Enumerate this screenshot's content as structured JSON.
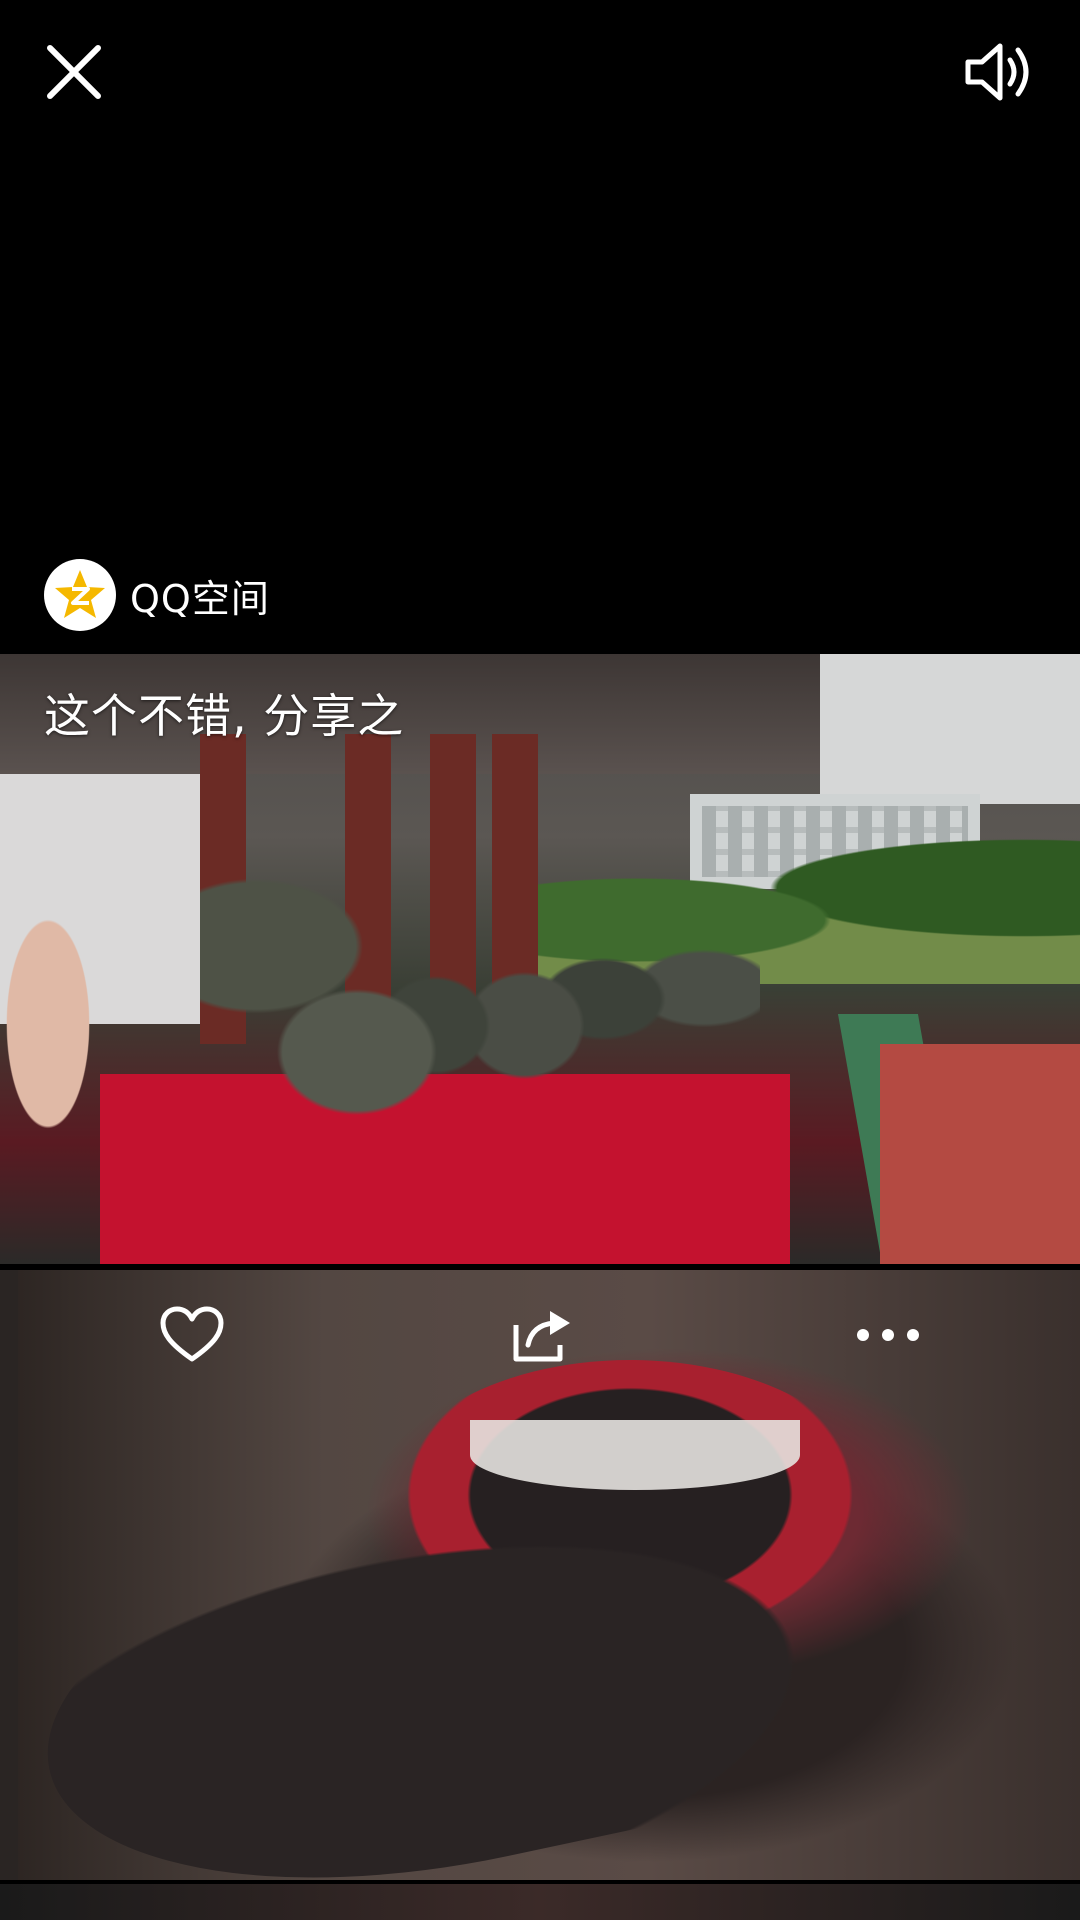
{
  "top_bar": {
    "close_icon": "close-icon",
    "volume_icon": "volume-icon"
  },
  "post": {
    "source_name": "QQ空间",
    "source_icon": "qq-zone-star-icon",
    "caption": "这个不错, 分享之"
  },
  "actions": {
    "like_icon": "heart-icon",
    "share_icon": "share-icon",
    "more_icon": "more-dots-icon"
  },
  "colors": {
    "background": "#000000",
    "qq_star": "#F5B800",
    "icon": "#FFFFFF"
  }
}
